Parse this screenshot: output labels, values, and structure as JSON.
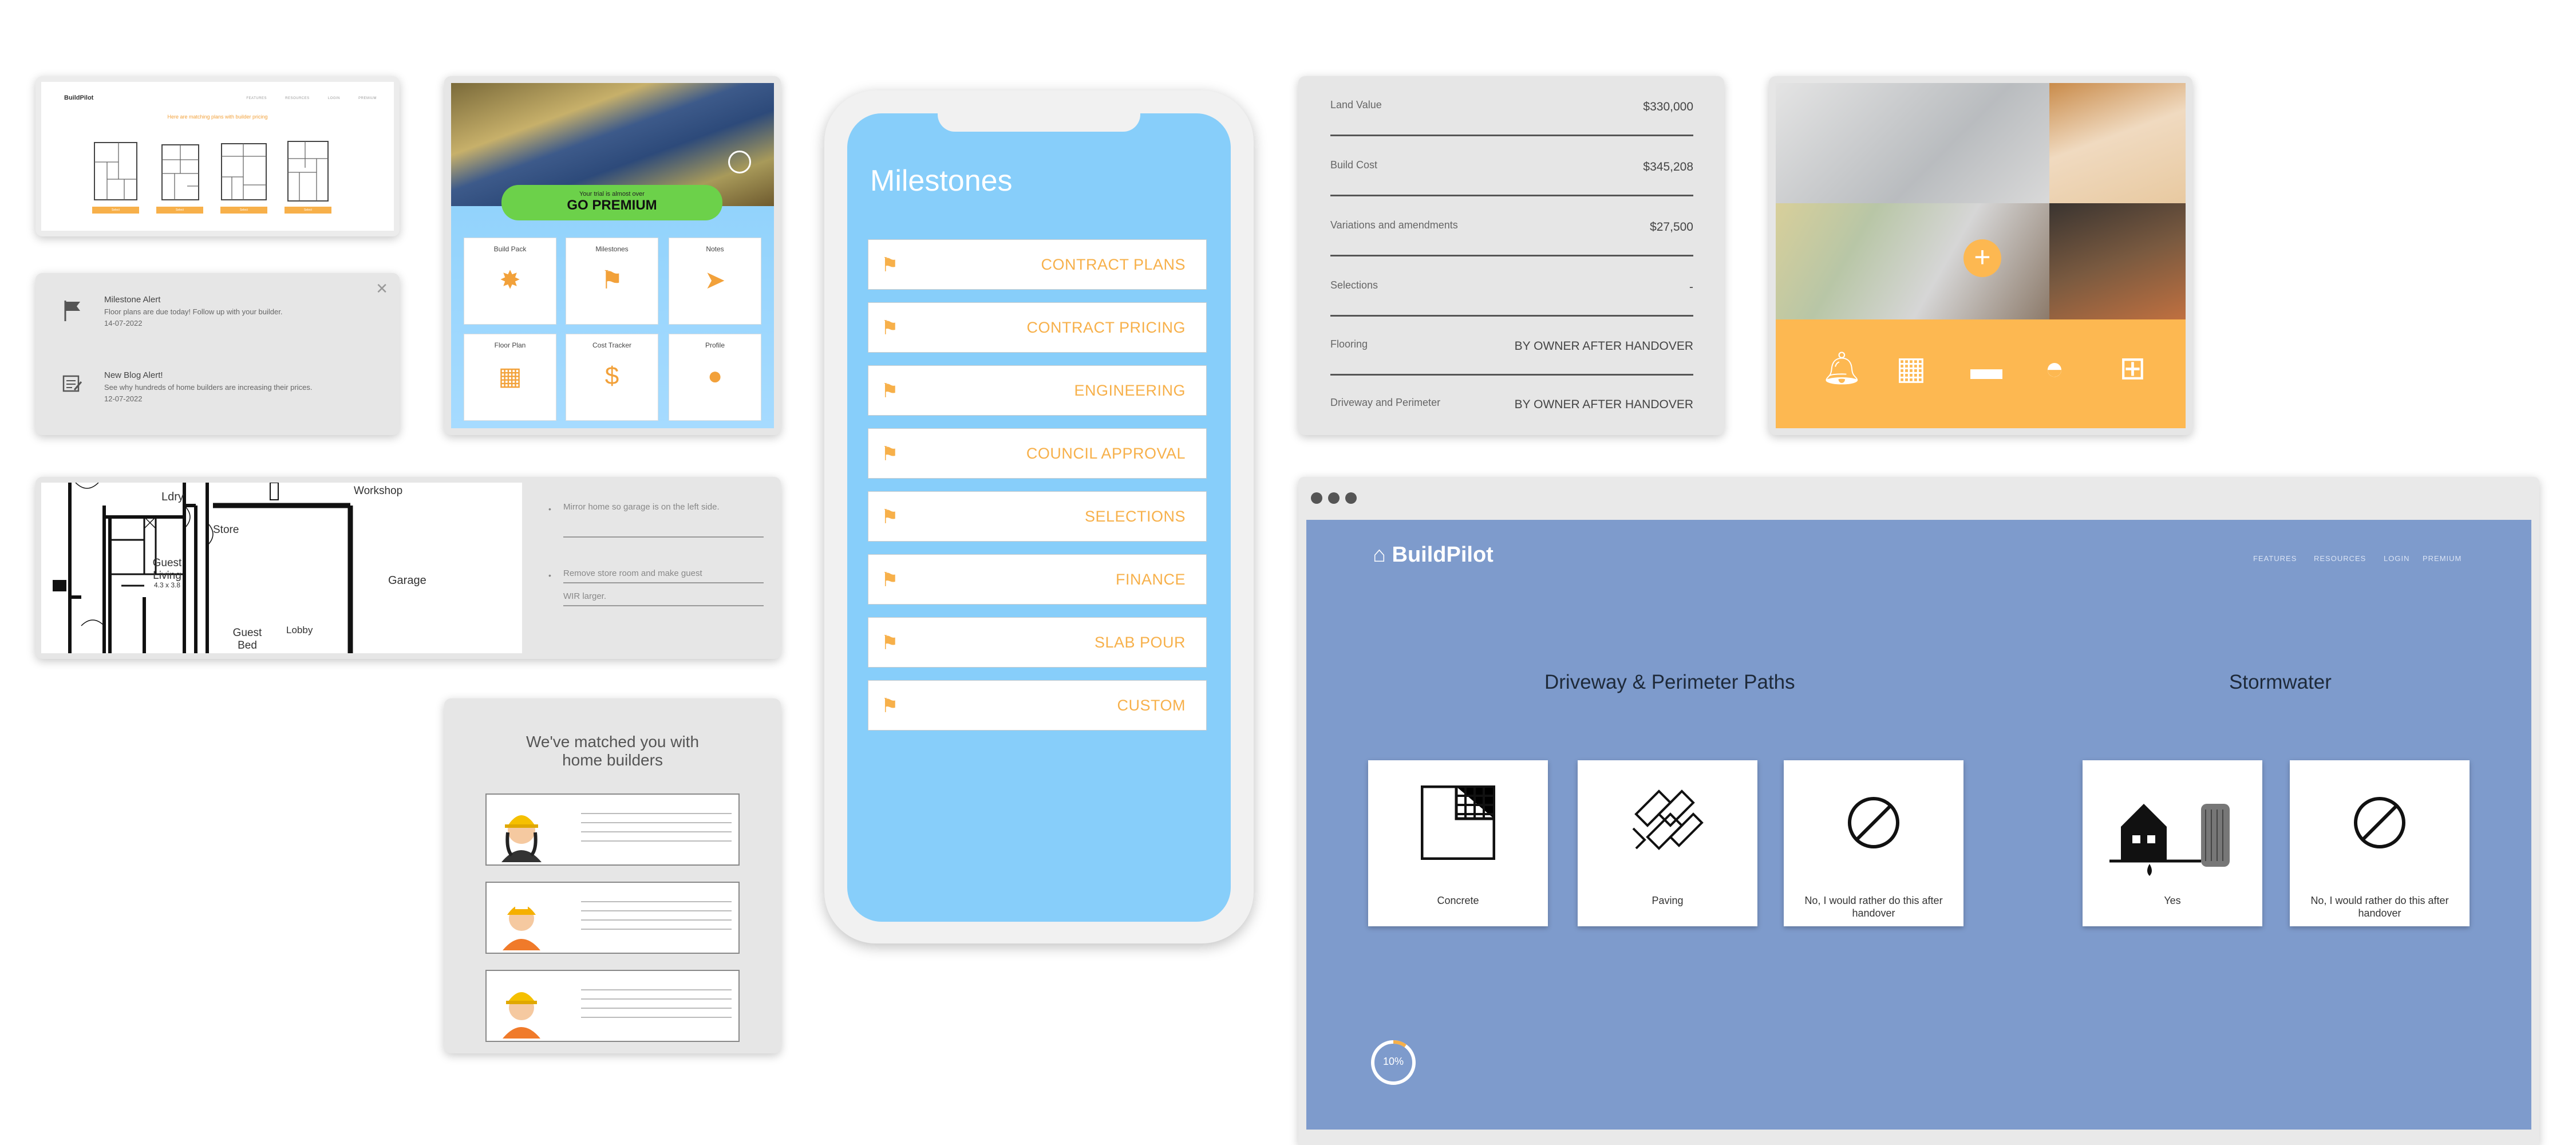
{
  "colors": {
    "accent": "#f7b04a",
    "sky": "#87cefa",
    "page_blue": "#7e9bcc",
    "premium_green": "#6cd14a"
  },
  "website_card": {
    "logo": "BuildPilot",
    "title": "Here are matching plans with builder pricing",
    "nav": [
      "FEATURES",
      "RESOURCES",
      "LOGIN",
      "PREMIUM"
    ],
    "plan_button": "Select"
  },
  "alerts": {
    "items": [
      {
        "icon": "flag-icon",
        "title": "Milestone Alert",
        "line": "Floor plans are due today! Follow up with your builder.",
        "date": "14-07-2022"
      },
      {
        "icon": "blog-icon",
        "title": "New Blog Alert!",
        "line": "See why hundreds of home builders are increasing their prices.",
        "date": "12-07-2022"
      }
    ],
    "close": "✕"
  },
  "floorplan": {
    "rooms": [
      "Ldry",
      "Store",
      "Guest Living",
      "4.3 x 3.8",
      "Guest Bed",
      "Lobby",
      "Workshop",
      "Garage"
    ],
    "notes": [
      "Mirror home so garage is on the left side.",
      "Remove store room and make guest",
      "WIR larger."
    ]
  },
  "premium": {
    "banner_small": "Your trial is almost over",
    "banner_big": "GO PREMIUM",
    "tiles": [
      {
        "label": "Build Pack",
        "icon": "box-icon"
      },
      {
        "label": "Milestones",
        "icon": "flag-icon"
      },
      {
        "label": "Notes",
        "icon": "paper-plane-icon"
      },
      {
        "label": "Floor Plan",
        "icon": "floorplan-icon"
      },
      {
        "label": "Cost Tracker",
        "icon": "money-icon"
      },
      {
        "label": "Profile",
        "icon": "user-icon"
      }
    ]
  },
  "matched": {
    "title_line1": "We've matched you with",
    "title_line2": "home builders"
  },
  "milestones": {
    "title": "Milestones",
    "items": [
      "CONTRACT PLANS",
      "CONTRACT PRICING",
      "ENGINEERING",
      "COUNCIL APPROVAL",
      "SELECTIONS",
      "FINANCE",
      "SLAB POUR",
      "CUSTOM"
    ]
  },
  "costs": [
    {
      "label": "Land Value",
      "value": "$330,000"
    },
    {
      "label": "Build Cost",
      "value": "$345,208"
    },
    {
      "label": "Variations and amendments",
      "value": "$27,500"
    },
    {
      "label": "Selections",
      "value": "-"
    },
    {
      "label": "Flooring",
      "value": "BY OWNER AFTER HANDOVER"
    },
    {
      "label": "Driveway and Perimeter",
      "value": "BY OWNER AFTER HANDOVER"
    }
  ],
  "gallery": {
    "icons": [
      "bell-icon",
      "floorplan-icon",
      "paint-roller-icon",
      "hardhat-icon",
      "layout-icon"
    ],
    "add": "+"
  },
  "browser": {
    "logo": "BuildPilot",
    "nav": [
      "FEATURES",
      "RESOURCES",
      "LOGIN",
      "PREMIUM"
    ],
    "section1": {
      "title": "Driveway & Perimeter Paths",
      "options": [
        "Concrete",
        "Paving",
        "No, I would rather do this after handover"
      ]
    },
    "section2": {
      "title": "Stormwater",
      "options": [
        "Yes",
        "No, I would rather do this after handover"
      ]
    },
    "progress": {
      "label": "10%",
      "value": 0.1
    }
  }
}
